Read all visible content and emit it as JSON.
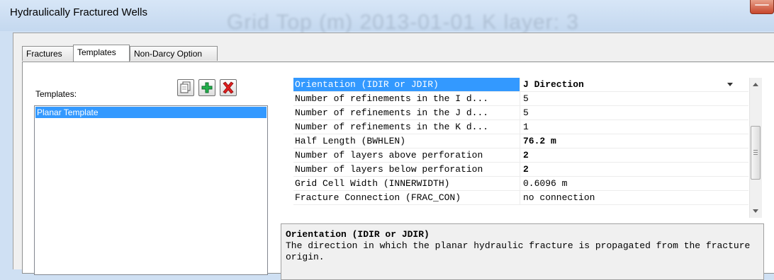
{
  "window": {
    "title": "Hydraulically Fractured Wells",
    "ghost_text": "Grid Top (m) 2013-01-01    K layer: 3"
  },
  "tabs": [
    {
      "label": "Fractures",
      "active": false
    },
    {
      "label": "Templates",
      "active": true
    },
    {
      "label": "Non-Darcy Option",
      "active": false
    }
  ],
  "templates_panel": {
    "label": "Templates:",
    "items": [
      "Planar Template"
    ],
    "buttons": [
      {
        "name": "copy",
        "icon": "copy-icon"
      },
      {
        "name": "add",
        "icon": "plus-icon",
        "color": "#22b14c"
      },
      {
        "name": "delete",
        "icon": "x-icon",
        "color": "#e02020"
      }
    ]
  },
  "properties": [
    {
      "label": "Orientation (IDIR or JDIR)",
      "value": "J Direction",
      "bold": true,
      "selected": true,
      "dropdown": true
    },
    {
      "label": "Number of refinements in the I d...",
      "value": "5",
      "bold": false
    },
    {
      "label": "Number of refinements in the J d...",
      "value": "5",
      "bold": false
    },
    {
      "label": "Number of refinements in the K d...",
      "value": "1",
      "bold": false
    },
    {
      "label": "Half Length (BWHLEN)",
      "value": "76.2 m",
      "bold": true
    },
    {
      "label": "Number of layers above perforation",
      "value": "2",
      "bold": true
    },
    {
      "label": "Number of layers below perforation",
      "value": "2",
      "bold": true
    },
    {
      "label": "Grid Cell Width (INNERWIDTH)",
      "value": "0.6096 m",
      "bold": false
    },
    {
      "label": "Fracture Connection (FRAC_CON)",
      "value": "no connection",
      "bold": false
    }
  ],
  "description": {
    "title": "Orientation (IDIR or JDIR)",
    "body": "The direction in which the planar hydraulic fracture is propagated from the fracture origin."
  },
  "colors": {
    "selection": "#3399ff",
    "title_bar": "#c4d8ef"
  }
}
